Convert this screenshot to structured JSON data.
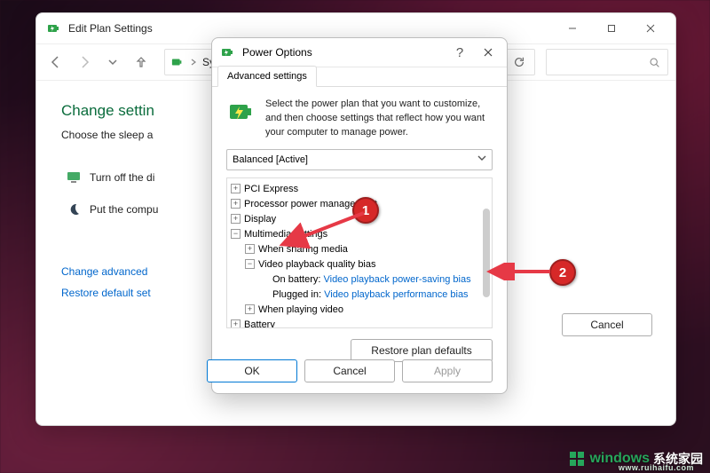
{
  "outer_window": {
    "title": "Edit Plan Settings",
    "address_label": "Syste",
    "heading": "Change settin",
    "subheading": "Choose the sleep a",
    "row_turn_off": "Turn off the di",
    "row_sleep": "Put the compu",
    "link_advanced": "Change advanced",
    "link_restore": "Restore default set",
    "btn_cancel": "Cancel"
  },
  "inner_dialog": {
    "title": "Power Options",
    "tab": "Advanced settings",
    "description": "Select the power plan that you want to customize, and then choose settings that reflect how you want your computer to manage power.",
    "combo_value": "Balanced [Active]",
    "restore_defaults": "Restore plan defaults",
    "btn_ok": "OK",
    "btn_cancel": "Cancel",
    "btn_apply": "Apply"
  },
  "tree": {
    "pci": "PCI Express",
    "ppm": "Processor power management",
    "display": "Display",
    "multimedia": "Multimedia settings",
    "sharing": "When sharing media",
    "vpqb": "Video playback quality bias",
    "on_battery_label": "On battery:",
    "on_battery_value": "Video playback power-saving bias",
    "plugged_label": "Plugged in:",
    "plugged_value": "Video playback performance bias",
    "playing_video": "When playing video",
    "battery": "Battery"
  },
  "annotations": {
    "badge1": "1",
    "badge2": "2"
  },
  "watermark": {
    "brand": "windows",
    "suffix": "系统家园",
    "url": "www.ruihaifu.com"
  }
}
